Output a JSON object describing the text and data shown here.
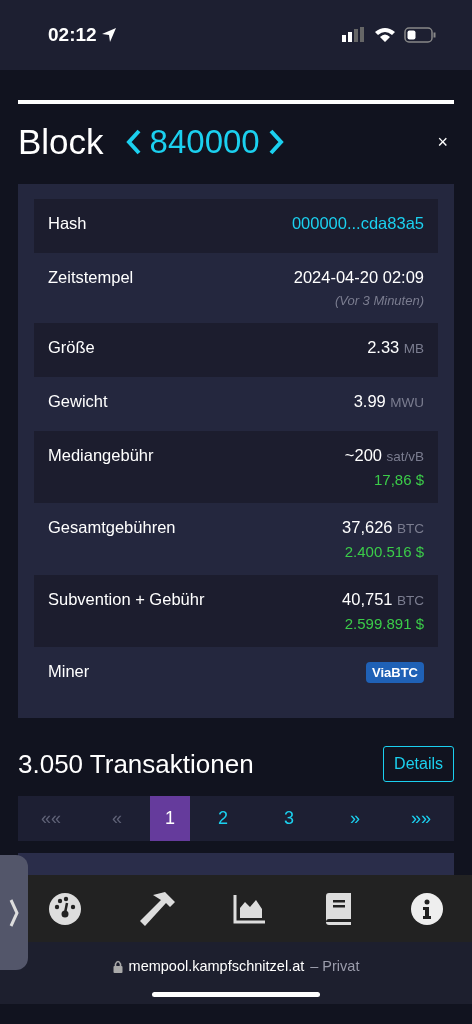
{
  "status_bar": {
    "time": "02:12"
  },
  "header": {
    "title": "Block",
    "block_number": "840000",
    "close": "×"
  },
  "details": [
    {
      "kind": "link",
      "label": "Hash",
      "value": "000000...cda83a5"
    },
    {
      "kind": "plain",
      "label": "Zeitstempel",
      "value": "2024-04-20 02:09",
      "note": "(Vor 3 Minuten)"
    },
    {
      "kind": "plain",
      "label": "Größe",
      "value": "2.33",
      "unit": "MB"
    },
    {
      "kind": "plain",
      "label": "Gewicht",
      "value": "3.99",
      "unit": "MWU"
    },
    {
      "kind": "plain",
      "label": "Mediangebühr",
      "value": "~200",
      "unit": "sat/vB",
      "fiat": "17,86 $"
    },
    {
      "kind": "plain",
      "label": "Gesamtgebühren",
      "value": "37,626",
      "unit": "BTC",
      "fiat": "2.400.516 $"
    },
    {
      "kind": "plain",
      "label": "Subvention + Gebühr",
      "value": "40,751",
      "unit": "BTC",
      "fiat": "2.599.891 $"
    },
    {
      "kind": "badge",
      "label": "Miner",
      "value": "ViaBTC"
    }
  ],
  "transactions": {
    "title": "3.050 Transaktionen",
    "details_button": "Details"
  },
  "pagination": [
    {
      "label": "««",
      "selected": false,
      "disabled": true
    },
    {
      "label": "«",
      "selected": false,
      "disabled": true
    },
    {
      "label": "1",
      "selected": true,
      "disabled": false
    },
    {
      "label": "2",
      "selected": false,
      "disabled": false
    },
    {
      "label": "3",
      "selected": false,
      "disabled": false
    },
    {
      "label": "»",
      "selected": false,
      "disabled": false
    },
    {
      "label": "»»",
      "selected": false,
      "disabled": false
    }
  ],
  "toolbar": [
    {
      "kind": "gauge"
    },
    {
      "kind": "hammer"
    },
    {
      "kind": "chart"
    },
    {
      "kind": "book"
    },
    {
      "kind": "info"
    }
  ],
  "address_bar": {
    "domain": "mempool.kampfschnitzel.at",
    "mode": "– Privat"
  }
}
